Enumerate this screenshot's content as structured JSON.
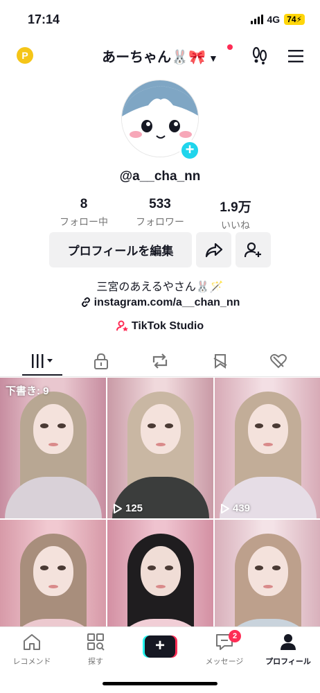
{
  "status": {
    "time": "17:14",
    "network": "4G",
    "battery": "74"
  },
  "header": {
    "username": "あーちゃん🐰🎀",
    "coin_icon": "coin-icon",
    "chevron": "⌄"
  },
  "profile": {
    "handle": "@a__cha_nn",
    "stats": [
      {
        "value": "8",
        "label": "フォロー中"
      },
      {
        "value": "533",
        "label": "フォロワー"
      },
      {
        "value": "1.9万",
        "label": "いいね"
      }
    ],
    "edit_button": "プロフィールを編集",
    "bio": "三宮のあえるやさん🐰🪄",
    "link": "instagram.com/a__chan_nn",
    "studio": "TikTok Studio"
  },
  "tabs": [
    "videos-grid-icon",
    "lock-icon",
    "repost-icon",
    "saved-icon",
    "liked-icon"
  ],
  "videos": [
    {
      "overlay": "下書き: 9",
      "views": ""
    },
    {
      "overlay": "",
      "views": "125"
    },
    {
      "overlay": "",
      "views": "439"
    },
    {
      "overlay": "",
      "views": ""
    },
    {
      "overlay": "",
      "views": ""
    },
    {
      "overlay": "",
      "views": ""
    }
  ],
  "nav": {
    "home": "レコメンド",
    "discover": "探す",
    "inbox": "メッセージ",
    "inbox_badge": "2",
    "profile": "プロフィール"
  },
  "colors": {
    "accent": "#fe2c55",
    "cyan": "#20d5ec",
    "text": "#161823"
  }
}
